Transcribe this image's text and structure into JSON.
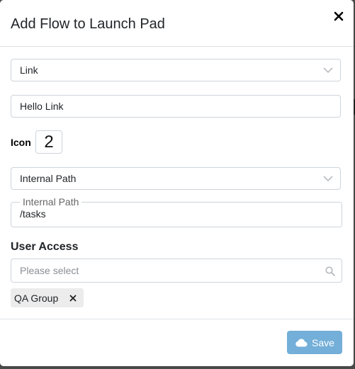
{
  "modal": {
    "title": "Add Flow to Launch Pad"
  },
  "form": {
    "type_select": {
      "value": "Link"
    },
    "name_input": {
      "value": "Hello Link"
    },
    "icon": {
      "label": "Icon",
      "value": "2"
    },
    "path_type_select": {
      "value": "Internal Path"
    },
    "internal_path": {
      "label": "Internal Path",
      "value": "/tasks"
    },
    "user_access": {
      "label": "User Access",
      "placeholder": "Please select",
      "selected": [
        {
          "label": "QA Group"
        }
      ]
    }
  },
  "footer": {
    "save_label": "Save"
  },
  "colors": {
    "save_button_bg": "#73afd8",
    "border": "#ced4da",
    "chip_bg": "#ececec"
  },
  "icons": {
    "close": "close-icon",
    "chevron": "chevron-down-icon",
    "search": "search-icon",
    "cloud": "cloud-icon",
    "remove": "remove-icon"
  }
}
